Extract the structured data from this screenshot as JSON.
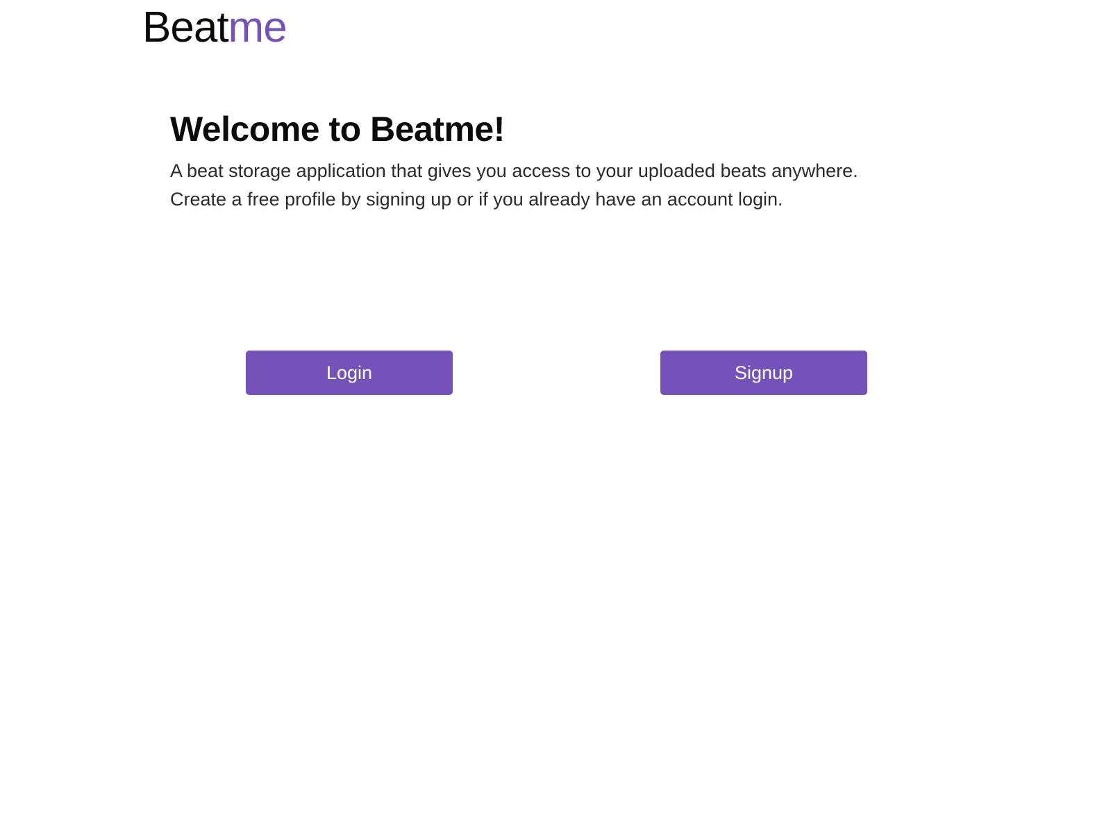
{
  "header": {
    "brand_primary": "Beat",
    "brand_accent": "me"
  },
  "main": {
    "title": "Welcome to Beatme!",
    "description_line1": "A beat storage application that gives you access to your uploaded beats anywhere.",
    "description_line2": "Create a free profile by signing up or if you already have an account login."
  },
  "actions": {
    "login_label": "Login",
    "signup_label": "Signup"
  },
  "colors": {
    "accent": "#7452b9",
    "text": "#0b0b0b",
    "body_text": "#2b2b2b",
    "background": "#ffffff"
  }
}
